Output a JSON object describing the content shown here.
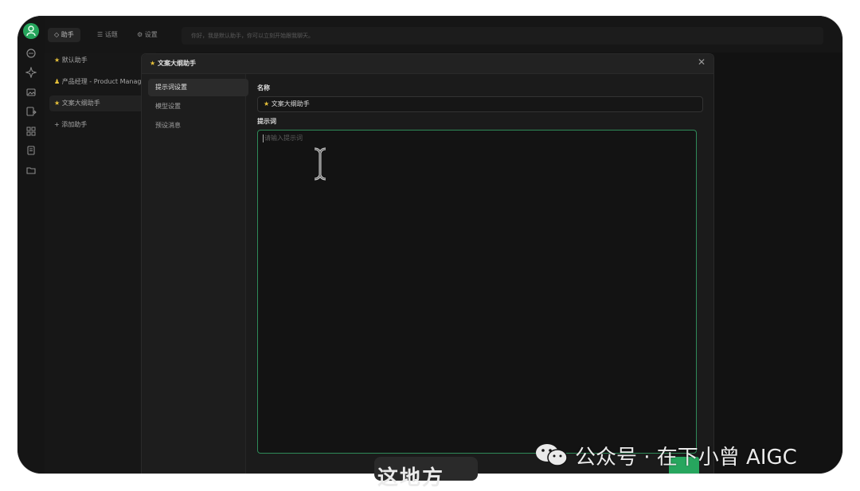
{
  "topbar": {
    "assistant_tab": "◇ 助手",
    "topics_tab": "☰ 话题",
    "settings_tab": "⚙ 设置",
    "search_placeholder": "你好，我是默认助手，你可以立刻开始跟我聊天。"
  },
  "assistants": [
    {
      "icon": "★",
      "label": "默认助手"
    },
    {
      "icon": "👤",
      "label": "产品经理 - Product Manager"
    },
    {
      "icon": "★",
      "label": "文案大纲助手"
    },
    {
      "icon": "+",
      "label": "添加助手"
    }
  ],
  "modal": {
    "title_icon": "★",
    "title": "文案大纲助手",
    "close": "✕",
    "tabs": [
      "提示词设置",
      "模型设置",
      "预设消息"
    ],
    "name_label": "名称",
    "name_value": "★ 文案大纲助手",
    "prompt_label": "提示词",
    "prompt_placeholder": "请输入提示词"
  },
  "subtitle": "这地方",
  "watermark": "公众号 · 在下小曾 AIGC",
  "colors": {
    "accent": "#27a65e",
    "star": "#e8c23a",
    "background": "#141414"
  }
}
